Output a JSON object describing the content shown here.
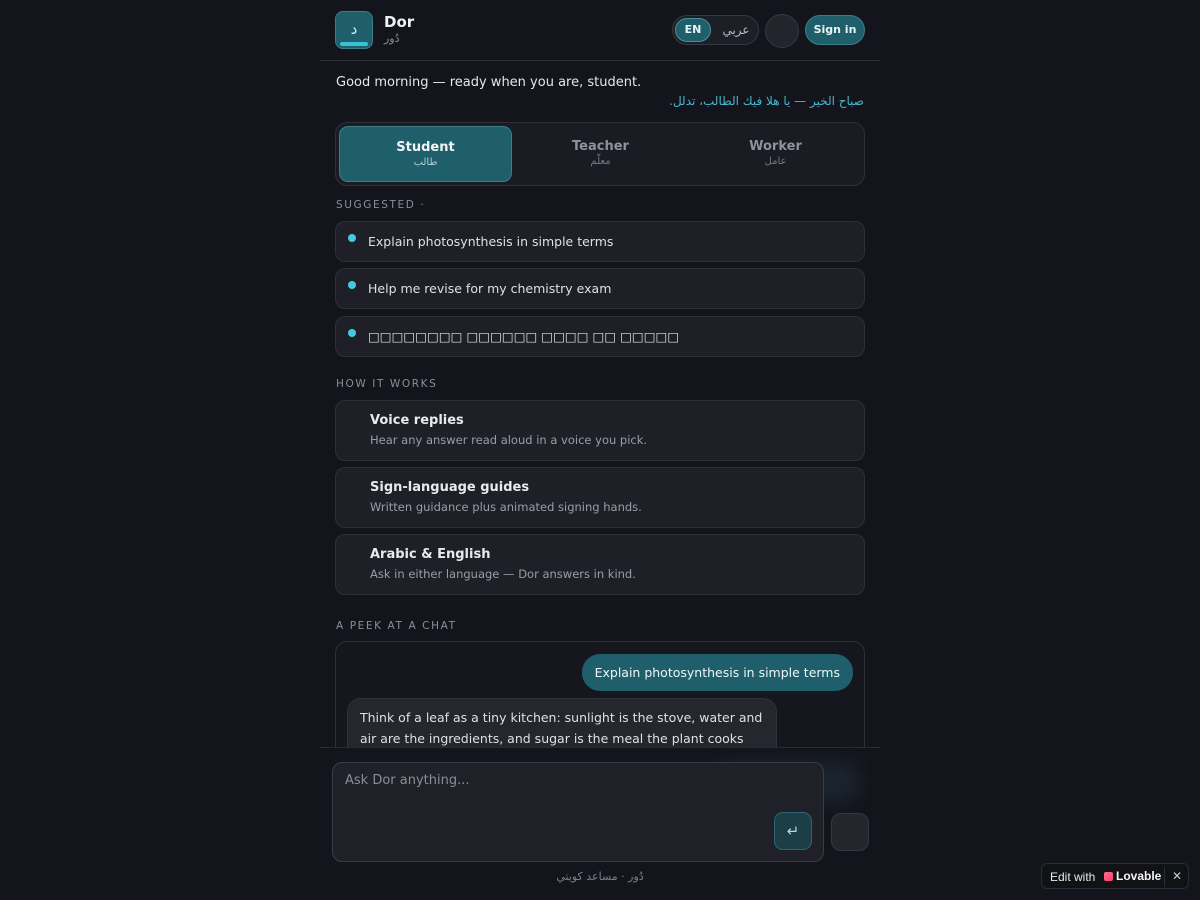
{
  "header": {
    "logo_glyph": "د",
    "brand_name": "Dor",
    "brand_sub": "دُور",
    "lang_en": "EN",
    "lang_ar": "عربي",
    "signin_label": "Sign in"
  },
  "greeting": {
    "en": "Good morning — ready when you are, student.",
    "ar": "صباح الخير — يا هلا فيك الطالب، تدلل."
  },
  "roles": [
    {
      "en": "Student",
      "ar": "طالب",
      "active": true
    },
    {
      "en": "Teacher",
      "ar": "معلّم",
      "active": false
    },
    {
      "en": "Worker",
      "ar": "عامل",
      "active": false
    }
  ],
  "suggested": {
    "label": "SUGGESTED ·",
    "items": [
      "Explain photosynthesis in simple terms",
      "Help me revise for my chemistry exam",
      "□□□□□□□□ □□□□□□ □□□□ □□ □□□□□"
    ]
  },
  "how_it_works": {
    "label": "HOW IT WORKS",
    "items": [
      {
        "title": "Voice replies",
        "desc": "Hear any answer read aloud in a voice you pick."
      },
      {
        "title": "Sign-language guides",
        "desc": "Written guidance plus animated signing hands."
      },
      {
        "title": "Arabic & English",
        "desc": "Ask in either language — Dor answers in kind."
      }
    ]
  },
  "chat_peek": {
    "label": "A PEEK AT A CHAT",
    "user_message": "Explain photosynthesis in simple terms",
    "bot_message": "Think of a leaf as a tiny kitchen: sunlight is the stove, water and air are the ingredients, and sugar is the meal the plant cooks for itself."
  },
  "composer": {
    "placeholder": "Ask Dor anything...",
    "send_glyph": "↵",
    "footer_note": "دُور · مساعد كويتي"
  },
  "lovable": {
    "edit_with": "Edit with",
    "brand": "Lovable",
    "close": "✕"
  }
}
